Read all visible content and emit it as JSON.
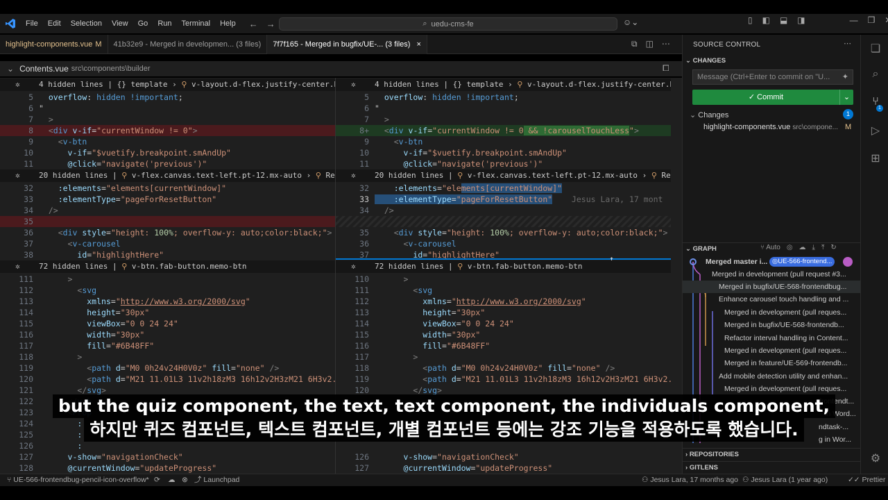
{
  "titlebar": {
    "menu": [
      "File",
      "Edit",
      "Selection",
      "View",
      "Go",
      "Run",
      "Terminal",
      "Help"
    ],
    "search": "uedu-cms-fe",
    "copilot": "⌄"
  },
  "tabs": [
    {
      "label": "highlight-components.vue",
      "badge": "M"
    },
    {
      "label": "41b32e9 - Merged in developmen... (3 files)"
    },
    {
      "label": "7f7f165 - Merged in bugfix/UE-... (3 files)",
      "close": "×"
    }
  ],
  "breadcrumb": {
    "file": "Contents.vue",
    "path": "src\\components\\builder"
  },
  "editor": {
    "hidden": [
      {
        "count": "4 hidden lines",
        "crumbs": [
          "{} template",
          "v-layout.d-flex.justify-center.background.overflow-y-a"
        ]
      },
      {
        "count": "20 hidden lines",
        "crumbs": [
          "v-flex.canvas.text-left.pt-12.mx-auto",
          "ResetAnswerButton"
        ]
      },
      {
        "count": "72 hidden lines",
        "crumbs": [
          "v-btn.fab-button.memo-btn"
        ]
      }
    ],
    "blame_inline": "Jesus Lara, 17 mont"
  },
  "sidebar": {
    "title": "SOURCE CONTROL",
    "changes_header": "CHANGES",
    "message_placeholder": "Message (Ctrl+Enter to commit on \"U...",
    "commit_label": "✓ Commit",
    "changes_group": "Changes",
    "changes_count": "1",
    "file": {
      "name": "highlight-components.vue",
      "path": "src\\compone...",
      "status": "M"
    },
    "graph_header": "GRAPH",
    "graph_auto": "Auto",
    "graph": [
      {
        "msg": "Merged master i...",
        "tag": "UE-566-frontend..."
      },
      {
        "msg": "Merged in development (pull request #3..."
      },
      {
        "msg": "Merged in bugfix/UE-568-frontendbug..."
      },
      {
        "msg": "Enhance carousel touch handling and ..."
      },
      {
        "msg": "Merged in development (pull reques..."
      },
      {
        "msg": "Merged in bugfix/UE-568-frontendb..."
      },
      {
        "msg": "Refactor interval handling in Content..."
      },
      {
        "msg": "Merged in development (pull reques..."
      },
      {
        "msg": "Merged in feature/UE-569-frontendb..."
      },
      {
        "msg": "Add mobile detection utility and enhan..."
      },
      {
        "msg": "Merged in development (pull reques..."
      },
      {
        "msg": "frontendt..."
      },
      {
        "msg": "in Word..."
      },
      {
        "msg": "ndtask-..."
      },
      {
        "msg": "g in Wor..."
      }
    ],
    "repositories": "REPOSITORIES",
    "gitlens": "GITLENS"
  },
  "status": {
    "branch": "UE-566-frontendbug-pencil-icon-overflow*",
    "launchpad": "Launchpad",
    "blame1": "Jesus Lara, 17 months ago",
    "blame2": "Jesus Lara (1 year ago)",
    "prettier": "Prettier"
  },
  "subtitles": {
    "en": "but the quiz component, the text, text component, the individuals component,",
    "ko": "하지만 퀴즈 컴포넌트, 텍스트 컴포넌트, 개별 컴포넌트 등에는 강조 기능을 적용하도록 했습니다."
  },
  "colors": {
    "accent": "#0078d4",
    "commit": "#1f8a3e",
    "deleted": "#4b1a1d",
    "inserted": "#1e3b22"
  }
}
